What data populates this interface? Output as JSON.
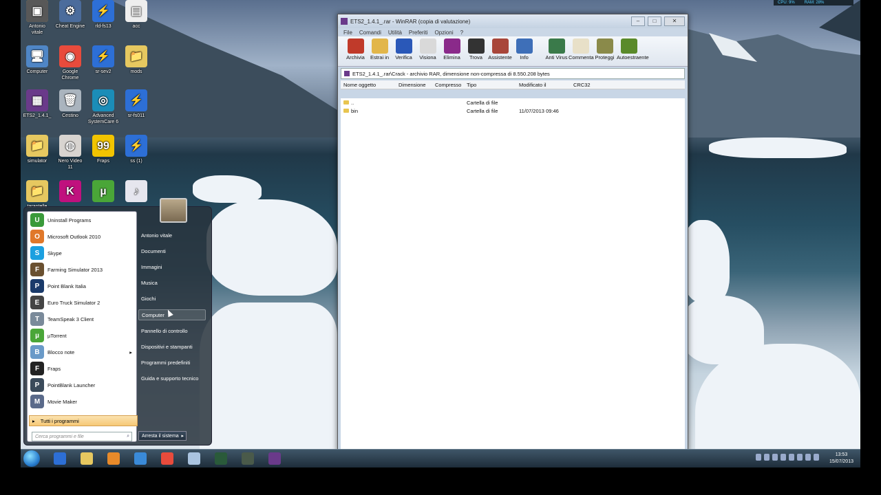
{
  "desktop_icons": [
    {
      "label": "Antonio\nvitale",
      "color": "#d8b44a",
      "glyph": "📁"
    },
    {
      "label": "Cheat Engine",
      "color": "#4b6c9c",
      "glyph": "⚙"
    },
    {
      "label": "rld-fs13",
      "color": "#2d6fd6",
      "glyph": "⚡"
    },
    {
      "label": "acc",
      "color": "#eeeeee",
      "glyph": "▤"
    },
    {
      "label": "Computer",
      "color": "#4f86c6",
      "glyph": "🖥"
    },
    {
      "label": "Google\nChrome",
      "color": "#e84b3c",
      "glyph": "◉"
    },
    {
      "label": "sr-sev2",
      "color": "#2d6fd6",
      "glyph": "⚡"
    },
    {
      "label": "mods",
      "color": "#e6c860",
      "glyph": "📁"
    },
    {
      "label": "ETS2_1.4.1_",
      "color": "#6a3a8a",
      "glyph": "▦"
    },
    {
      "label": "Cestino",
      "color": "#aab4be",
      "glyph": "🗑"
    },
    {
      "label": "Advanced\nSystemCare 6",
      "color": "#1b8db8",
      "glyph": "◎"
    },
    {
      "label": "sr-fs011",
      "color": "#2d6fd6",
      "glyph": "⚡"
    },
    {
      "label": "simulator",
      "color": "#e6c860",
      "glyph": "📁"
    },
    {
      "label": "Nero Video\n11",
      "color": "#d8d4d0",
      "glyph": "◍"
    },
    {
      "label": "Fraps",
      "color": "#f2c400",
      "glyph": "99"
    },
    {
      "label": "ss (1)",
      "color": "#2d6fd6",
      "glyph": "⚡"
    },
    {
      "label": "tarantelle",
      "color": "#e6c860",
      "glyph": "📁"
    },
    {
      "label": "",
      "color": "#c0117e",
      "glyph": "K"
    },
    {
      "label": "",
      "color": "#4aa638",
      "glyph": "µ"
    },
    {
      "label": "",
      "color": "#e6e6ee",
      "glyph": "♪"
    },
    {
      "label": "",
      "color": "#585858",
      "glyph": "▣"
    }
  ],
  "winrar": {
    "title": "ETS2_1.4.1_.rar - WinRAR (copia di valutazione)",
    "menu": [
      "File",
      "Comandi",
      "Utilità",
      "Preferiti",
      "Opzioni",
      "?"
    ],
    "toolbar": [
      {
        "label": "Archivia",
        "color": "#c03a2a"
      },
      {
        "label": "Estrai in",
        "color": "#e2b64a"
      },
      {
        "label": "Verifica",
        "color": "#2a58b8"
      },
      {
        "label": "Visiona",
        "color": "#d9d9d9"
      },
      {
        "label": "Elimina",
        "color": "#8a2a8a"
      },
      {
        "label": "Trova",
        "color": "#333333"
      },
      {
        "label": "Assistente",
        "color": "#a8463a"
      },
      {
        "label": "Info",
        "color": "#3e6fb8"
      },
      {
        "label": "Anti Virus",
        "color": "#3a7a4a"
      },
      {
        "label": "Commenta",
        "color": "#e8e0c8"
      },
      {
        "label": "Proteggi",
        "color": "#8a8a4a"
      },
      {
        "label": "Autoestraente",
        "color": "#5a8a2a"
      }
    ],
    "path": "ETS2_1.4.1_.rar\\Crack - archivio RAR, dimensione non-compressa di 8.550.208 bytes",
    "columns": [
      "Nome oggetto",
      "Dimensione",
      "Compresso",
      "Tipo",
      "Modificato il",
      "CRC32"
    ],
    "rows": [
      {
        "name": "..",
        "size": "",
        "packed": "",
        "type": "Cartella di file",
        "modified": "",
        "crc": ""
      },
      {
        "name": "bin",
        "size": "",
        "packed": "",
        "type": "Cartella di file",
        "modified": "11/07/2013 09:46",
        "crc": ""
      }
    ]
  },
  "start_menu": {
    "programs": [
      {
        "label": "Uninstall Programs",
        "color": "#3a9a3a",
        "glyph": "U"
      },
      {
        "label": "Microsoft Outlook 2010",
        "color": "#e0782a",
        "glyph": "O"
      },
      {
        "label": "Skype",
        "color": "#1ca0e0",
        "glyph": "S"
      },
      {
        "label": "Farming Simulator 2013",
        "color": "#6a5030",
        "glyph": "F"
      },
      {
        "label": "Point Blank Italia",
        "color": "#1a3a6a",
        "glyph": "P"
      },
      {
        "label": "Euro Truck Simulator 2",
        "color": "#444444",
        "glyph": "E"
      },
      {
        "label": "TeamSpeak 3 Client",
        "color": "#7a8a9a",
        "glyph": "T"
      },
      {
        "label": "µTorrent",
        "color": "#4aa638",
        "glyph": "µ"
      },
      {
        "label": "Blocco note",
        "color": "#6a9ac8",
        "glyph": "B",
        "arrow": "▸"
      },
      {
        "label": "Fraps",
        "color": "#222222",
        "glyph": "F"
      },
      {
        "label": "PointBlank Launcher",
        "color": "#3a4a5a",
        "glyph": "P"
      },
      {
        "label": "Movie Maker",
        "color": "#5a6a8a",
        "glyph": "M"
      }
    ],
    "all_programs": "Tutti i programmi",
    "search_placeholder": "Cerca programmi e file",
    "right_items": [
      "Antonio vitale",
      "Documenti",
      "Immagini",
      "Musica",
      "Giochi",
      "Computer",
      "Pannello di controllo",
      "Dispositivi e stampanti",
      "Programmi predefiniti",
      "Guida e supporto tecnico"
    ],
    "highlighted": "Computer",
    "shutdown": "Arresta il sistema"
  },
  "taskbar": {
    "time": "13:53",
    "date": "15/07/2013",
    "perf_cpu": "CPU: 9%",
    "perf_ram": "RAM: 28%",
    "apps": [
      {
        "name": "thunder",
        "color": "#2d6fd6"
      },
      {
        "name": "explorer",
        "color": "#e6c860"
      },
      {
        "name": "media-player",
        "color": "#e88a2a"
      },
      {
        "name": "ie",
        "color": "#3a8ad8"
      },
      {
        "name": "chrome",
        "color": "#e84b3c"
      },
      {
        "name": "notepad",
        "color": "#aac4e0"
      },
      {
        "name": "game1",
        "color": "#2a5a3a"
      },
      {
        "name": "game2",
        "color": "#4a5a4a"
      },
      {
        "name": "winrar",
        "color": "#6a3a8a"
      }
    ]
  }
}
